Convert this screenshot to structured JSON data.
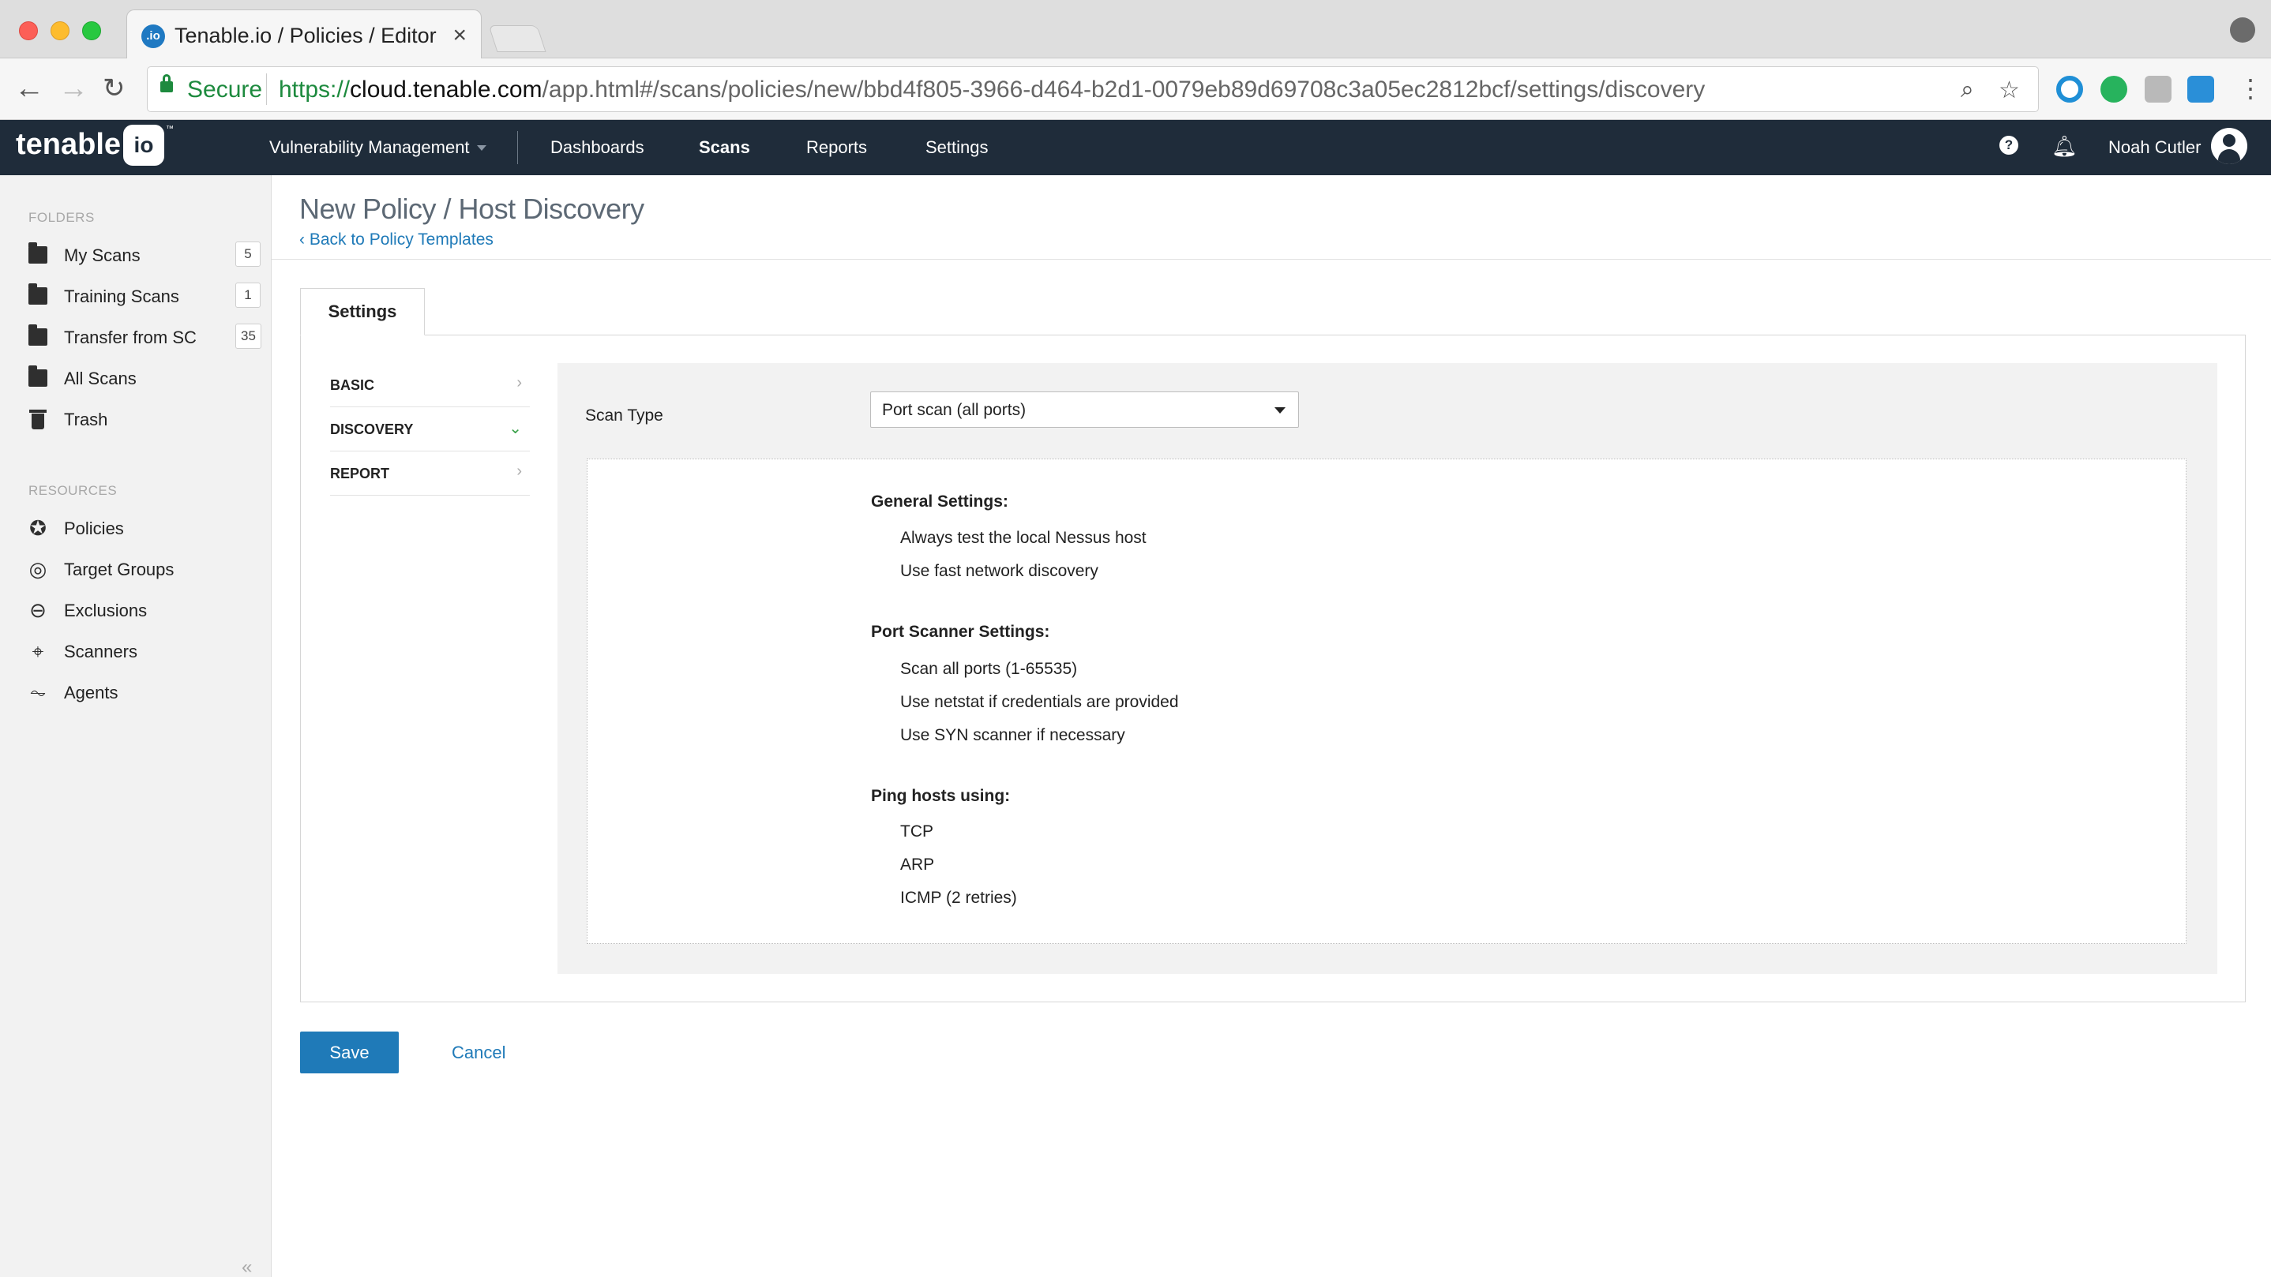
{
  "browser": {
    "tab_title": "Tenable.io / Policies / Editor",
    "tab_favicon_text": ".io",
    "secure_label": "Secure",
    "url_scheme": "https://",
    "url_host": "cloud.tenable.com",
    "url_path": "/app.html#/scans/policies/new/bbd4f805-3966-d464-b2d1-0079eb89d69708c3a05ec2812bcf/settings/discovery"
  },
  "appnav": {
    "logo_text": "tenable",
    "logo_io": "io",
    "logo_tm": "™",
    "product": "Vulnerability Management",
    "items": [
      "Dashboards",
      "Scans",
      "Reports",
      "Settings"
    ],
    "active_item": "Scans",
    "user_name": "Noah Cutler"
  },
  "sidebar": {
    "folders_heading": "FOLDERS",
    "folders": [
      {
        "label": "My Scans",
        "count": "5"
      },
      {
        "label": "Training Scans",
        "count": "1"
      },
      {
        "label": "Transfer from SC",
        "count": "35"
      },
      {
        "label": "All Scans"
      },
      {
        "label": "Trash"
      }
    ],
    "resources_heading": "RESOURCES",
    "resources": [
      {
        "label": "Policies",
        "icon": "shield-star-icon"
      },
      {
        "label": "Target Groups",
        "icon": "target-icon"
      },
      {
        "label": "Exclusions",
        "icon": "minus-circle-icon"
      },
      {
        "label": "Scanners",
        "icon": "radar-icon"
      },
      {
        "label": "Agents",
        "icon": "pulse-icon"
      }
    ],
    "collapse_glyph": "«"
  },
  "page": {
    "title": "New Policy / Host Discovery",
    "back_link": "Back to Policy Templates",
    "settings_tab": "Settings",
    "subnav": [
      "BASIC",
      "DISCOVERY",
      "REPORT"
    ],
    "active_subnav": "DISCOVERY",
    "scan_type_label": "Scan Type",
    "scan_type_value": "Port scan (all ports)",
    "summary": {
      "general_heading": "General Settings:",
      "general_items": [
        "Always test the local Nessus host",
        "Use fast network discovery"
      ],
      "port_heading": "Port Scanner Settings:",
      "port_items": [
        "Scan all ports (1-65535)",
        "Use netstat if credentials are provided",
        "Use SYN scanner if necessary"
      ],
      "ping_heading": "Ping hosts using:",
      "ping_items": [
        "TCP",
        "ARP",
        "ICMP (2 retries)"
      ]
    },
    "save_label": "Save",
    "cancel_label": "Cancel"
  },
  "colors": {
    "nav_bg": "#1f2c3a",
    "link_blue": "#1f7ab8",
    "secure_green": "#1d8a3e"
  }
}
